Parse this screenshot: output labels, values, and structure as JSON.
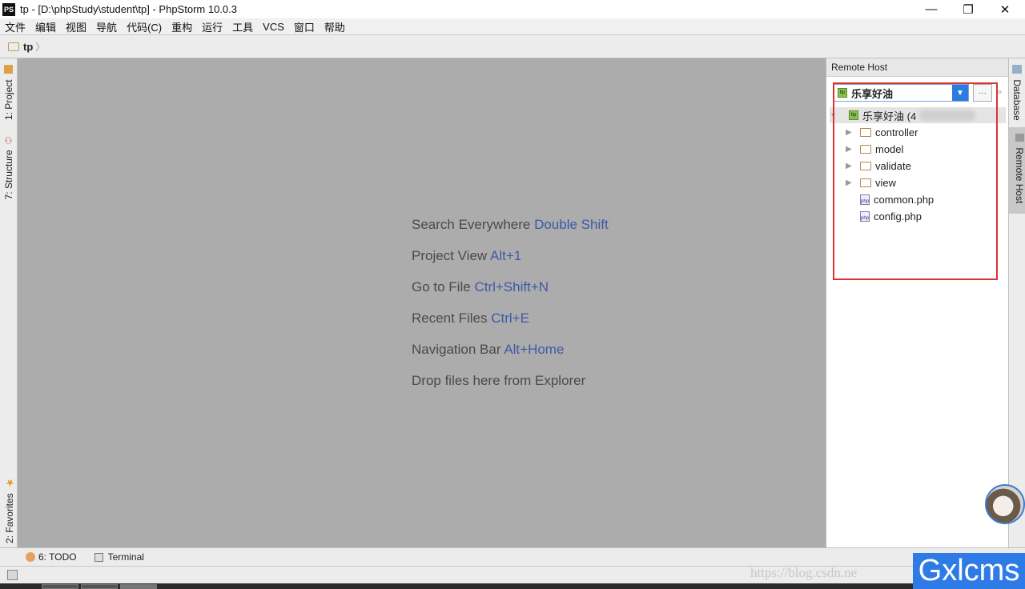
{
  "window": {
    "app_icon": "PS",
    "title": "tp - [D:\\phpStudy\\student\\tp] - PhpStorm 10.0.3",
    "minimize": "—",
    "restore": "❐",
    "close": "✕"
  },
  "menu": [
    "文件",
    "编辑",
    "视图",
    "导航",
    "代码(C)",
    "重构",
    "运行",
    "工具",
    "VCS",
    "窗口",
    "帮助"
  ],
  "navbar": {
    "crumb": "tp",
    "chevron": "〉"
  },
  "toolbar": {
    "run_config": "▾",
    "run": "▶",
    "debug": "✹",
    "coverage": "▩",
    "stop": "⊘",
    "search": "⚲"
  },
  "left_tabs": {
    "project": "1: Project",
    "structure": "7: Structure",
    "favorites": "2: Favorites"
  },
  "editor_hints": [
    {
      "text": "Search Everywhere",
      "key": "Double Shift"
    },
    {
      "text": "Project View",
      "key": "Alt+1"
    },
    {
      "text": "Go to File",
      "key": "Ctrl+Shift+N"
    },
    {
      "text": "Recent Files",
      "key": "Ctrl+E"
    },
    {
      "text": "Navigation Bar",
      "key": "Alt+Home"
    },
    {
      "text": "Drop files here from Explorer",
      "key": ""
    }
  ],
  "remote_host": {
    "title": "Remote Host",
    "gear": "⚙▾",
    "hide": "→|",
    "server_selected": "乐享好油",
    "more": "···",
    "expand": "»",
    "root": "乐享好油 (4",
    "items": [
      {
        "name": "controller",
        "type": "folder"
      },
      {
        "name": "model",
        "type": "folder"
      },
      {
        "name": "validate",
        "type": "folder"
      },
      {
        "name": "view",
        "type": "folder"
      },
      {
        "name": "common.php",
        "type": "php"
      },
      {
        "name": "config.php",
        "type": "php"
      }
    ]
  },
  "right_tabs": {
    "database": "Database",
    "remote_host": "Remote Host"
  },
  "bottom_tabs": {
    "todo": "6: TODO",
    "terminal": "Terminal"
  },
  "watermark": {
    "url": "https://blog.csdn.ne",
    "brand": "Gxlcms"
  }
}
